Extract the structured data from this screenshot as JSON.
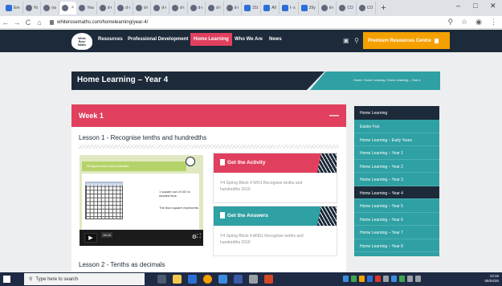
{
  "browser": {
    "tabs": [
      "Em",
      "Yo",
      "oa",
      "×",
      "Yea",
      "d-i",
      "d-i",
      "d-i",
      "d-i",
      "d-i",
      "d-i",
      "d-i",
      "d-i",
      "21t",
      "All",
      "t- x",
      "29y",
      "d-i",
      "CO",
      "CO"
    ],
    "new_tab_label": "+",
    "window_controls": [
      "–",
      "□",
      "✕"
    ],
    "url": "whiterosemaths.com/homelearning/year-4/",
    "nav_back": "←",
    "nav_forward": "→",
    "nav_reload": "C",
    "nav_home": "⌂"
  },
  "site": {
    "logo_lines": [
      "White",
      "Rose",
      "Maths"
    ],
    "nav": {
      "resources": "Resources",
      "professional_development": "Professional Development",
      "home_learning": "Home Learning",
      "who_we_are": "Who We Are",
      "news": "News"
    },
    "premium_label": "Premium Resources Centre",
    "accent_pink": "#e0405e",
    "accent_teal": "#2fa0a3",
    "navy": "#1c2a3a",
    "premium_orange": "#f4a000"
  },
  "hero": {
    "title": "Home Learning – Year 4",
    "breadcrumb": "Home / Home Learning / Home Learning – Year 4"
  },
  "week": {
    "title": "Week 1",
    "collapse_symbol": "—",
    "lesson1_title": "Lesson 1 - Recognise tenths and hundredths",
    "lesson2_title": "Lesson 2 - Tenths as decimals",
    "video": {
      "banner": "Recognise tenths and hundredths",
      "text1": "1 square out of 100 is shaded blue.",
      "text2": "The blue square represents",
      "time": "15:16"
    },
    "activity": {
      "label": "Get the Activity",
      "desc": "Y4 Spring Block 4 WO1 Recognise tenths and hundredths 2019"
    },
    "answers": {
      "label": "Get the Answers",
      "desc": "Y4 Spring Block 4 ANS1 Recognise tenths and hundredths 2019"
    }
  },
  "sidebar": {
    "heading": "Home Learning",
    "items": [
      "Easter Fun",
      "Home Learning – Early Years",
      "Home Learning – Year 1",
      "Home Learning – Year 2",
      "Home Learning – Year 3",
      "Home Learning – Year 4",
      "Home Learning – Year 5",
      "Home Learning – Year 6",
      "Home Learning – Year 7",
      "Home Learning – Year 8"
    ]
  },
  "taskbar": {
    "search_placeholder": "Type here to search",
    "time": "13:16",
    "date": "06/04/20"
  }
}
